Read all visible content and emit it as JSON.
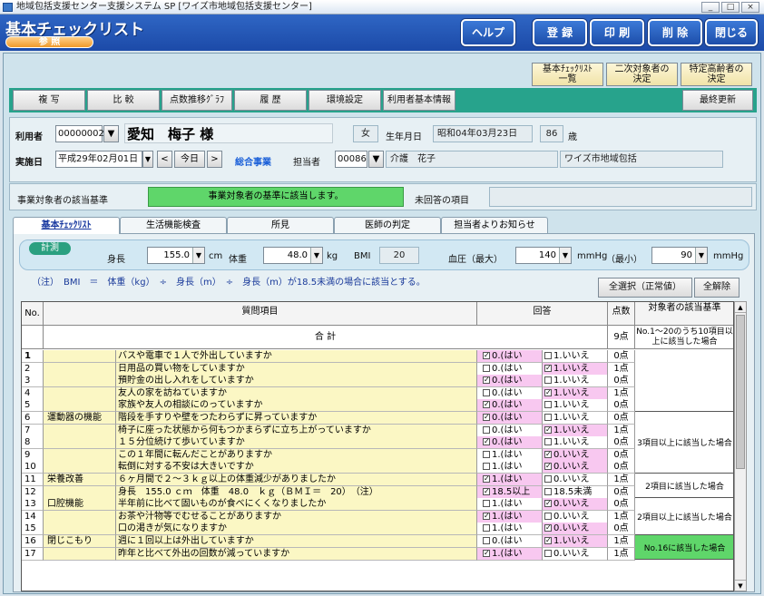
{
  "window": {
    "title": "地域包括支援センター支援システム SP [ワイズ市地域包括支援センター]",
    "controls": [
      "_",
      "□",
      "×"
    ]
  },
  "header": {
    "app_title": "基本チェックリスト",
    "mode": "参 照",
    "buttons": {
      "help": "ヘルプ",
      "register": "登 録",
      "print": "印 刷",
      "delete": "削 除",
      "close": "閉じる"
    }
  },
  "top_buttons": {
    "list": "基本ﾁｪｯｸﾘｽﾄ\n一覧",
    "secondary": "二次対象者の\n決定",
    "elderly": "特定高齢者の\n決定"
  },
  "toolbar": {
    "copy": "複 写",
    "compare": "比 較",
    "score_graph": "点数推移ｸﾞﾗﾌ",
    "history": "履 歴",
    "env": "環境設定",
    "user_info": "利用者基本情報",
    "last_update": "最終更新"
  },
  "user": {
    "label": "利用者",
    "id": "00000002",
    "name": "愛知　梅子 様",
    "gender": "女",
    "birth_label": "生年月日",
    "birth": "昭和04年03月23日",
    "age": "86",
    "age_unit": "歳",
    "impl_label": "実施日",
    "impl_date": "平成29年02月01日",
    "prev": "<",
    "today": "今日",
    "next": ">",
    "program": "総合事業",
    "staff_label": "担当者",
    "staff_id": "00086",
    "staff_name": "介護　花子",
    "org": "ワイズ市地域包括"
  },
  "criteria": {
    "label": "事業対象者の該当基準",
    "status": "事業対象者の基準に該当します。",
    "unanswered_label": "未回答の項目",
    "unanswered": ""
  },
  "tabs": [
    "基本ﾁｪｯｸﾘｽﾄ",
    "生活機能検査",
    "所見",
    "医師の判定",
    "担当者よりお知らせ"
  ],
  "measure": {
    "tag": "計測",
    "height_label": "身長",
    "height": "155.0",
    "height_unit": "cm",
    "weight_label": "体重",
    "weight": "48.0",
    "weight_unit": "kg",
    "bmi_label": "BMI",
    "bmi": "20",
    "bp_label": "血圧（最大）",
    "bp_max": "140",
    "bp_unit": "mmHg",
    "bp_min_label": "（最小）",
    "bp_min": "90",
    "bp_unit2": "mmHg"
  },
  "note": "（注）　BMI　＝　体重（kg）　÷　身長（m）　÷　身長（m）が18.5未満の場合に該当とする。",
  "select_all": "全選択（正常値）",
  "clear_all": "全解除",
  "grid": {
    "headers": {
      "no": "No.",
      "question": "質問項目",
      "answer": "回答",
      "score": "点数",
      "criteria": "対象者の該当基準"
    },
    "total_label": "合 計",
    "total_score": "9点",
    "total_criteria": "No.1～20のうち10項目以上に該当した場合",
    "rows": [
      {
        "no": "1",
        "cat": "",
        "q": "バスや電車で１人で外出していますか",
        "a": "0.(はい",
        "b": "1.いいえ",
        "ac": true,
        "bc": false,
        "score": "0点"
      },
      {
        "no": "2",
        "cat": "",
        "q": "日用品の買い物をしていますか",
        "a": "0.(はい",
        "b": "1.いいえ",
        "ac": false,
        "bc": true,
        "score": "1点"
      },
      {
        "no": "3",
        "cat": "",
        "q": "預貯金の出し入れをしていますか",
        "a": "0.(はい",
        "b": "1.いいえ",
        "ac": true,
        "bc": false,
        "score": "0点"
      },
      {
        "no": "4",
        "cat": "",
        "q": "友人の家を訪ねていますか",
        "a": "0.(はい",
        "b": "1.いいえ",
        "ac": false,
        "bc": true,
        "score": "1点"
      },
      {
        "no": "5",
        "cat": "",
        "q": "家族や友人の相談にのっていますか",
        "a": "0.(はい",
        "b": "1.いいえ",
        "ac": true,
        "bc": false,
        "score": "0点"
      },
      {
        "no": "6",
        "cat": "運動器の機能",
        "q": "階段を手すりや壁をつたわらずに昇っていますか",
        "a": "0.(はい",
        "b": "1.いいえ",
        "ac": true,
        "bc": false,
        "score": "0点"
      },
      {
        "no": "7",
        "cat": "",
        "q": "椅子に座った状態から何もつかまらずに立ち上がっていますか",
        "a": "0.(はい",
        "b": "1.いいえ",
        "ac": false,
        "bc": true,
        "score": "1点"
      },
      {
        "no": "8",
        "cat": "",
        "q": "１５分位続けて歩いていますか",
        "a": "0.(はい",
        "b": "1.いいえ",
        "ac": true,
        "bc": false,
        "score": "0点"
      },
      {
        "no": "9",
        "cat": "",
        "q": "この１年間に転んだことがありますか",
        "a": "1.(はい",
        "b": "0.いいえ",
        "ac": false,
        "bc": true,
        "score": "0点"
      },
      {
        "no": "10",
        "cat": "",
        "q": "転倒に対する不安は大きいですか",
        "a": "1.(はい",
        "b": "0.いいえ",
        "ac": false,
        "bc": true,
        "score": "0点"
      },
      {
        "no": "11",
        "cat": "栄養改善",
        "q": "６ヶ月間で２～３ｋｇ以上の体重減少がありましたか",
        "a": "1.(はい",
        "b": "0.いいえ",
        "ac": true,
        "bc": false,
        "score": "1点"
      },
      {
        "no": "12",
        "cat": "",
        "q": "身長　155.0 ｃｍ　体重　48.0　ｋｇ（ＢＭＩ＝　20）　（注）",
        "a": "18.5以上",
        "b": "18.5未満",
        "ac": true,
        "bc": false,
        "score": "0点"
      },
      {
        "no": "13",
        "cat": "口腔機能",
        "q": "半年前に比べて固いものが食べにくくなりましたか",
        "a": "1.(はい",
        "b": "0.いいえ",
        "ac": false,
        "bc": true,
        "score": "0点"
      },
      {
        "no": "14",
        "cat": "",
        "q": "お茶や汁物等でむせることがありますか",
        "a": "1.(はい",
        "b": "0.いいえ",
        "ac": true,
        "bc": false,
        "score": "1点"
      },
      {
        "no": "15",
        "cat": "",
        "q": "口の渇きが気になりますか",
        "a": "1.(はい",
        "b": "0.いいえ",
        "ac": false,
        "bc": true,
        "score": "0点"
      },
      {
        "no": "16",
        "cat": "閉じこもり",
        "q": "週に１回以上は外出していますか",
        "a": "0.(はい",
        "b": "1.いいえ",
        "ac": false,
        "bc": true,
        "score": "1点"
      },
      {
        "no": "17",
        "cat": "",
        "q": "昨年と比べて外出の回数が減っていますか",
        "a": "1.(はい",
        "b": "0.いいえ",
        "ac": true,
        "bc": false,
        "score": "1点"
      }
    ],
    "criteria_groups": [
      {
        "text": "",
        "bg": "#ffffff"
      },
      {
        "text": "3項目以上に該当した場合",
        "bg": "#ffffff"
      },
      {
        "text": "2項目に該当した場合",
        "bg": "#ffffff"
      },
      {
        "text": "2項目以上に該当した場合",
        "bg": "#ffffff"
      },
      {
        "text": "No.16に該当した場合",
        "bg": "#5fd66a"
      }
    ]
  },
  "colors": {
    "cat_bg": "#fbf7c4",
    "pink": "#f8c8f0",
    "green": "#5fd66a",
    "teal": "#27a38c",
    "blue": "#1f52b0"
  }
}
